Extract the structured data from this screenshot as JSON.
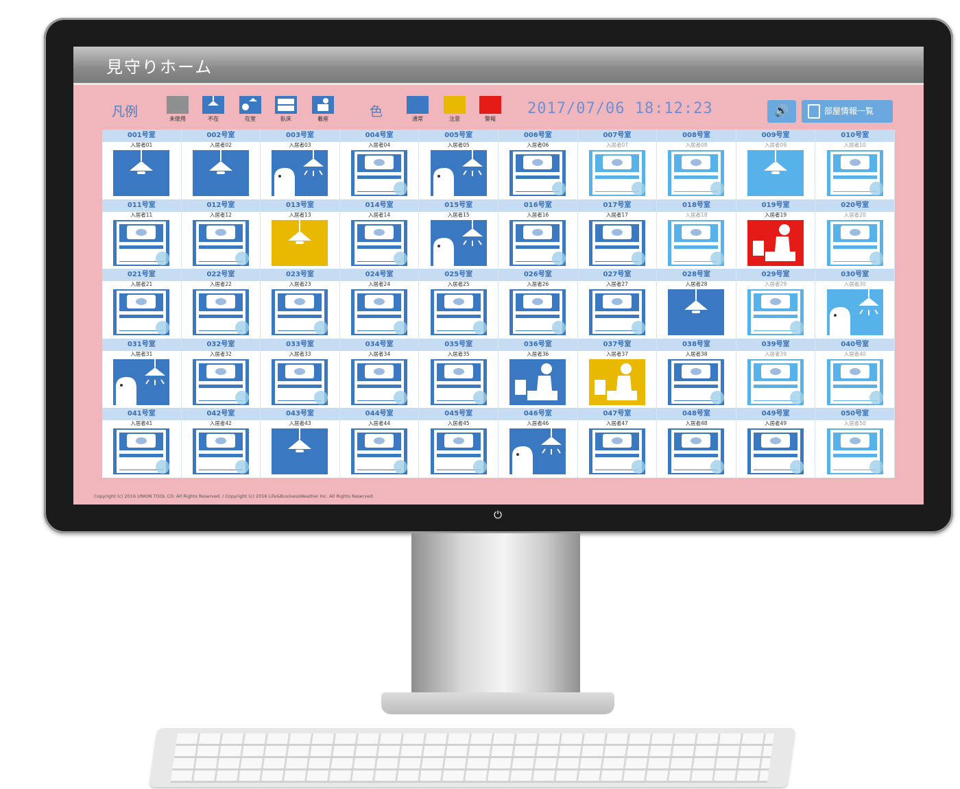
{
  "app": {
    "title": "見守りホーム"
  },
  "legend": {
    "label": "凡例",
    "items": [
      {
        "label": "未使用",
        "icon": "unused-icon",
        "color": "#8f8f8f"
      },
      {
        "label": "不在",
        "icon": "ceiling-light-icon",
        "color": "#3a78c2"
      },
      {
        "label": "在室",
        "icon": "person-in-room-icon",
        "color": "#3a78c2"
      },
      {
        "label": "臥床",
        "icon": "bed-icon",
        "color": "#3a78c2"
      },
      {
        "label": "着座",
        "icon": "seated-person-icon",
        "color": "#3a78c2"
      }
    ]
  },
  "colors": {
    "label": "色",
    "items": [
      {
        "label": "通常",
        "color": "#3a78c2"
      },
      {
        "label": "注意",
        "color": "#e9b800"
      },
      {
        "label": "警報",
        "color": "#e41b17"
      }
    ]
  },
  "datetime": "2017/07/06 18:12:23",
  "toolbar": {
    "sound_icon": "speaker-icon",
    "rooms_label": "部屋情報一覧"
  },
  "footer": "Copyright (c) 2016 UNION TOOL CO. All Rights Reserved. / Copyright (c) 2016 Life&BusinessWeather Inc. All Rights Reserved.",
  "rooms": [
    {
      "room": "001号室",
      "resident": "入居者01",
      "state": "light",
      "color": "normal"
    },
    {
      "room": "002号室",
      "resident": "入居者02",
      "state": "light",
      "color": "normal"
    },
    {
      "room": "003号室",
      "resident": "入居者03",
      "state": "present",
      "color": "normal"
    },
    {
      "room": "004号室",
      "resident": "入居者04",
      "state": "bed",
      "color": "normal"
    },
    {
      "room": "005号室",
      "resident": "入居者05",
      "state": "present",
      "color": "normal"
    },
    {
      "room": "006号室",
      "resident": "入居者06",
      "state": "bed",
      "color": "normal"
    },
    {
      "room": "007号室",
      "resident": "入居者07",
      "state": "bed",
      "color": "light"
    },
    {
      "room": "008号室",
      "resident": "入居者08",
      "state": "bed",
      "color": "light"
    },
    {
      "room": "009号室",
      "resident": "入居者09",
      "state": "light",
      "color": "light"
    },
    {
      "room": "010号室",
      "resident": "入居者10",
      "state": "bed",
      "color": "light"
    },
    {
      "room": "011号室",
      "resident": "入居者11",
      "state": "bed",
      "color": "normal"
    },
    {
      "room": "012号室",
      "resident": "入居者12",
      "state": "bed",
      "color": "normal"
    },
    {
      "room": "013号室",
      "resident": "入居者13",
      "state": "light",
      "color": "caution"
    },
    {
      "room": "014号室",
      "resident": "入居者14",
      "state": "bed",
      "color": "normal"
    },
    {
      "room": "015号室",
      "resident": "入居者15",
      "state": "present",
      "color": "normal"
    },
    {
      "room": "016号室",
      "resident": "入居者16",
      "state": "bed",
      "color": "normal"
    },
    {
      "room": "017号室",
      "resident": "入居者17",
      "state": "bed",
      "color": "normal"
    },
    {
      "room": "018号室",
      "resident": "入居者18",
      "state": "bed",
      "color": "light"
    },
    {
      "room": "019号室",
      "resident": "入居者19",
      "state": "seated",
      "color": "alarm"
    },
    {
      "room": "020号室",
      "resident": "入居者20",
      "state": "bed",
      "color": "light"
    },
    {
      "room": "021号室",
      "resident": "入居者21",
      "state": "bed",
      "color": "normal"
    },
    {
      "room": "022号室",
      "resident": "入居者22",
      "state": "bed",
      "color": "normal"
    },
    {
      "room": "023号室",
      "resident": "入居者23",
      "state": "bed",
      "color": "normal"
    },
    {
      "room": "024号室",
      "resident": "入居者24",
      "state": "bed",
      "color": "normal"
    },
    {
      "room": "025号室",
      "resident": "入居者25",
      "state": "bed",
      "color": "normal"
    },
    {
      "room": "026号室",
      "resident": "入居者26",
      "state": "bed",
      "color": "normal"
    },
    {
      "room": "027号室",
      "resident": "入居者27",
      "state": "bed",
      "color": "normal"
    },
    {
      "room": "028号室",
      "resident": "入居者28",
      "state": "light",
      "color": "normal"
    },
    {
      "room": "029号室",
      "resident": "入居者29",
      "state": "bed",
      "color": "light"
    },
    {
      "room": "030号室",
      "resident": "入居者30",
      "state": "present",
      "color": "light"
    },
    {
      "room": "031号室",
      "resident": "入居者31",
      "state": "present",
      "color": "normal"
    },
    {
      "room": "032号室",
      "resident": "入居者32",
      "state": "bed",
      "color": "normal"
    },
    {
      "room": "033号室",
      "resident": "入居者33",
      "state": "bed",
      "color": "normal"
    },
    {
      "room": "034号室",
      "resident": "入居者34",
      "state": "bed",
      "color": "normal"
    },
    {
      "room": "035号室",
      "resident": "入居者35",
      "state": "bed",
      "color": "normal"
    },
    {
      "room": "036号室",
      "resident": "入居者36",
      "state": "seated",
      "color": "normal"
    },
    {
      "room": "037号室",
      "resident": "入居者37",
      "state": "seated",
      "color": "caution"
    },
    {
      "room": "038号室",
      "resident": "入居者38",
      "state": "bed",
      "color": "normal"
    },
    {
      "room": "039号室",
      "resident": "入居者39",
      "state": "bed",
      "color": "light"
    },
    {
      "room": "040号室",
      "resident": "入居者40",
      "state": "bed",
      "color": "light"
    },
    {
      "room": "041号室",
      "resident": "入居者41",
      "state": "bed",
      "color": "normal"
    },
    {
      "room": "042号室",
      "resident": "入居者42",
      "state": "bed",
      "color": "normal"
    },
    {
      "room": "043号室",
      "resident": "入居者43",
      "state": "light",
      "color": "normal"
    },
    {
      "room": "044号室",
      "resident": "入居者44",
      "state": "bed",
      "color": "normal"
    },
    {
      "room": "045号室",
      "resident": "入居者45",
      "state": "bed",
      "color": "normal"
    },
    {
      "room": "046号室",
      "resident": "入居者46",
      "state": "present",
      "color": "normal"
    },
    {
      "room": "047号室",
      "resident": "入居者47",
      "state": "bed",
      "color": "normal"
    },
    {
      "room": "048号室",
      "resident": "入居者48",
      "state": "bed",
      "color": "normal"
    },
    {
      "room": "049号室",
      "resident": "入居者49",
      "state": "bed",
      "color": "normal"
    },
    {
      "room": "050号室",
      "resident": "入居者50",
      "state": "bed",
      "color": "light"
    }
  ]
}
